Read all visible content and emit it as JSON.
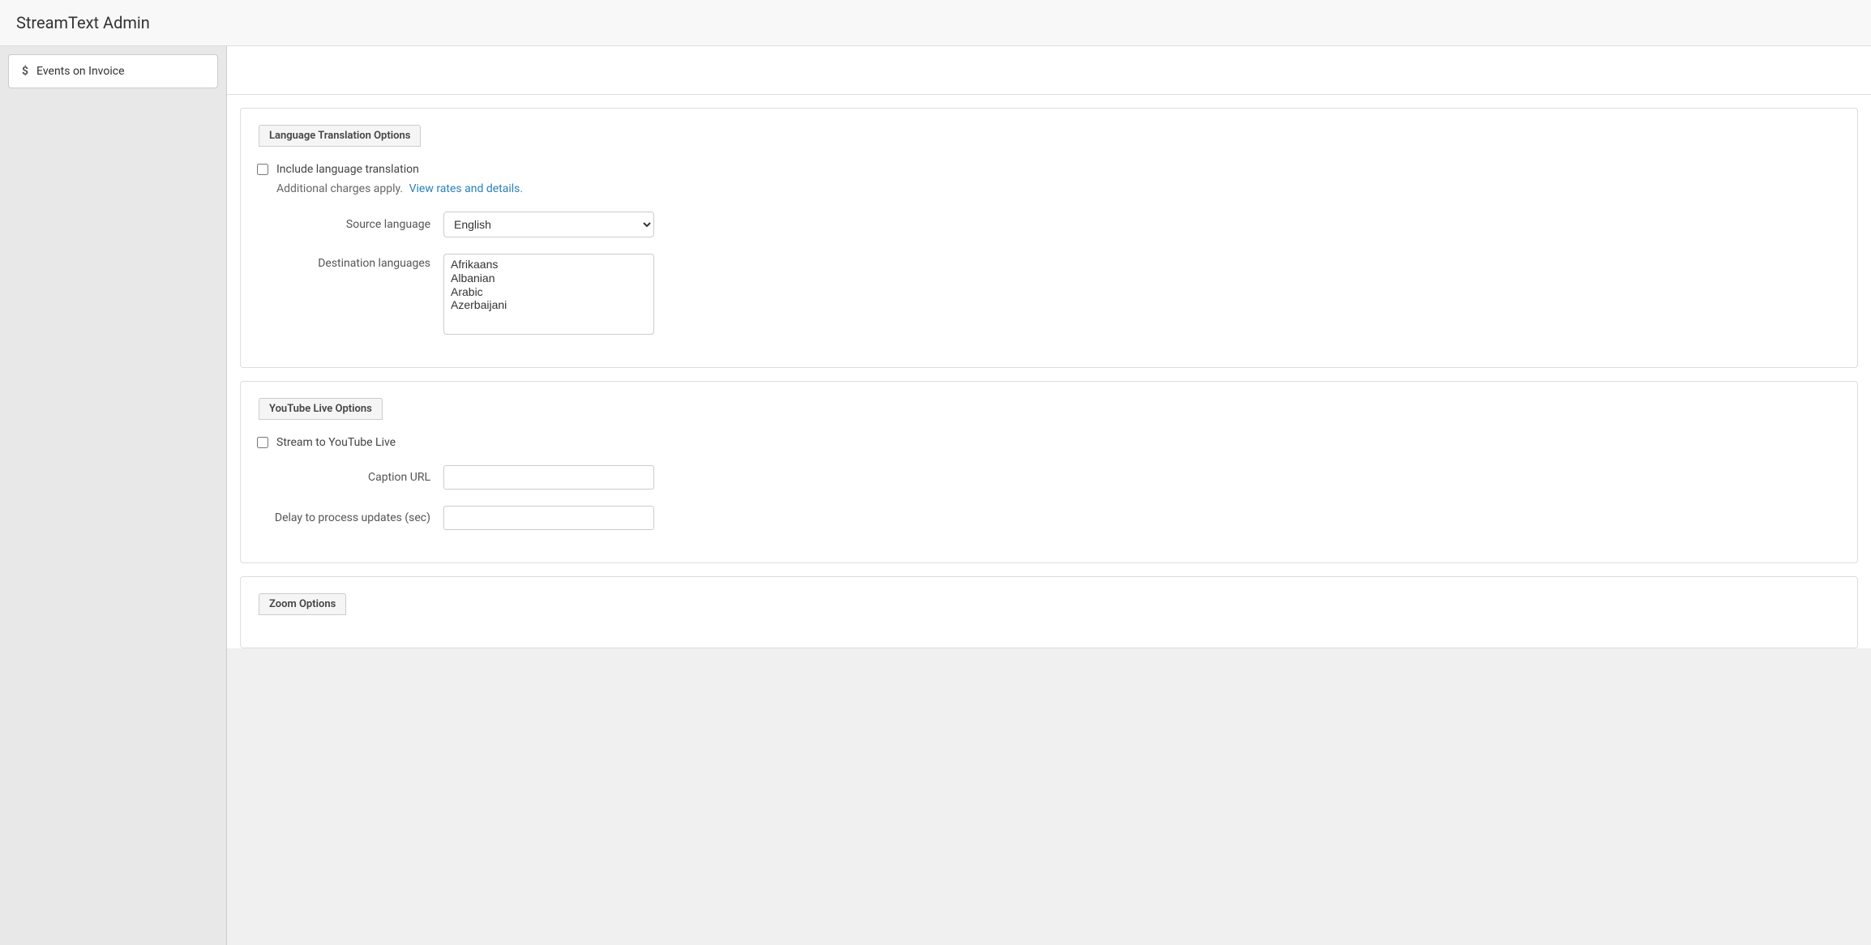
{
  "app": {
    "title": "StreamText Admin"
  },
  "sidebar": {
    "items": [
      {
        "id": "events-on-invoice",
        "label": "Events on Invoice",
        "icon": "$"
      }
    ]
  },
  "languageTranslation": {
    "sectionTitle": "Language Translation Options",
    "checkboxLabel": "Include language translation",
    "additionalChargesText": "Additional charges apply.",
    "viewRatesLink": "View rates and details.",
    "sourceLanguageLabel": "Source language",
    "sourceLanguageValue": "English",
    "destinationLanguagesLabel": "Destination languages",
    "destinationOptions": [
      "Afrikaans",
      "Albanian",
      "Arabic",
      "Azerbaijani"
    ]
  },
  "youtubeLive": {
    "sectionTitle": "YouTube Live Options",
    "checkboxLabel": "Stream to YouTube Live",
    "captionUrlLabel": "Caption URL",
    "captionUrlPlaceholder": "",
    "delayLabel": "Delay to process updates (sec)",
    "delayPlaceholder": ""
  },
  "zoom": {
    "sectionTitle": "Zoom Options"
  }
}
